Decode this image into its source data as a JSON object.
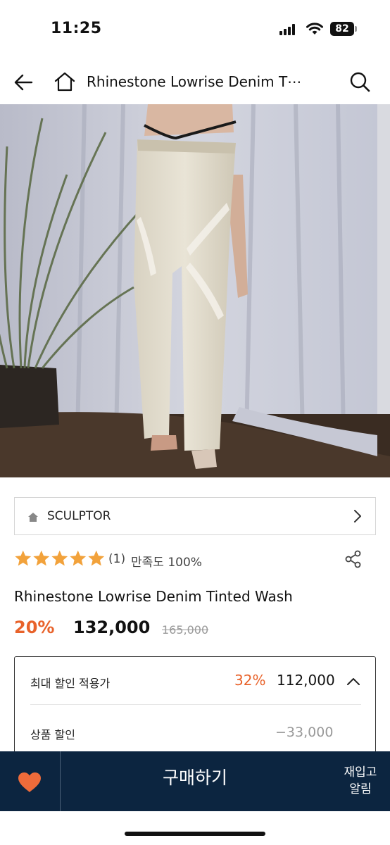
{
  "status_bar": {
    "time": "11:25",
    "battery": "82"
  },
  "header": {
    "title": "Rhinestone Lowrise Denim T⋯"
  },
  "brand": {
    "name": "SCULPTOR"
  },
  "rating": {
    "stars": 5,
    "count": "(1)",
    "satisfaction": "만족도 100%"
  },
  "product": {
    "name": "Rhinestone Lowrise Denim Tinted Wash",
    "discount_rate": "20%",
    "sale_price": "132,000",
    "original_price": "165,000"
  },
  "discount_box": {
    "max_label": "최대 할인 적용가",
    "max_rate": "32%",
    "max_price": "112,000",
    "product_discount_label": "상품 할인",
    "product_discount_value": "−33,000"
  },
  "bottom_bar": {
    "buy_label": "구매하기",
    "restock_line1": "재입고",
    "restock_line2": "알림"
  },
  "colors": {
    "accent": "#e8622a",
    "star": "#f2a23b",
    "bottom_bar": "#0c2540"
  },
  "icons": [
    "back-arrow-icon",
    "home-icon",
    "search-icon",
    "chevron-right-icon",
    "share-icon",
    "chevron-up-icon",
    "heart-icon"
  ]
}
